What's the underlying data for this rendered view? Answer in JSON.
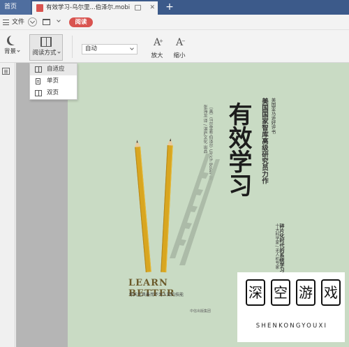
{
  "tabs": {
    "home": "首页",
    "document": "有效学习-乌尔里...伯泽尔.mobi"
  },
  "menubar": {
    "file": "文件",
    "read_button": "阅读"
  },
  "ribbon": {
    "background": "背景",
    "reading_mode": "阅读方式",
    "zoom_value": "自动",
    "zoom_in": "放大",
    "zoom_out": "缩小"
  },
  "reading_mode_menu": {
    "items": [
      {
        "label": "自适应",
        "icon": "fit-page-icon",
        "selected": true
      },
      {
        "label": "单页",
        "icon": "single-page-icon",
        "selected": false
      },
      {
        "label": "双页",
        "icon": "double-page-icon",
        "selected": false
      }
    ]
  },
  "cover": {
    "title": "有效学习",
    "subtitle": "美国国家智库高级研究员力作",
    "recommend": "美国亚马逊好评书",
    "author": "〔美〕乌尔里希·伯泽尔 Ulrich Boser 著",
    "translator": "张海龙 译 / 湛庐文化 出品",
    "side_heading": "碎片化时代的系统学习",
    "side_note": "十大科学家 / 无人机专家",
    "english_title": "LEARN BETTER",
    "tagline": "你天生具备而不为人知的技能",
    "publisher": "中信出版集团"
  },
  "watermark": {
    "chars": [
      "深",
      "空",
      "游",
      "戏"
    ],
    "latin": "SHENKONGYOUXI"
  },
  "colors": {
    "tab_bar": "#3c5a8a",
    "read_button": "#d9534f",
    "cover_bg": "#c9dbc4"
  }
}
